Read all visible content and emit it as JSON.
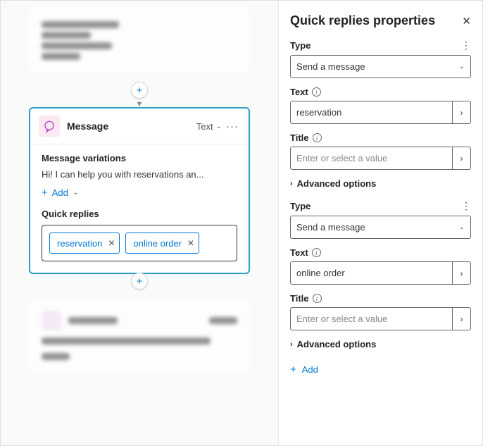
{
  "panel": {
    "title": "Quick replies properties",
    "type_label": "Type",
    "text_label": "Text",
    "title_label": "Title",
    "title_placeholder": "Enter or select a value",
    "advanced_label": "Advanced options",
    "add_label": "Add",
    "replies": [
      {
        "type_value": "Send a message",
        "text_value": "reservation"
      },
      {
        "type_value": "Send a message",
        "text_value": "online order"
      }
    ]
  },
  "node": {
    "title": "Message",
    "output_mode": "Text",
    "variations_label": "Message variations",
    "variation_preview": "Hi! I can help you with reservations an...",
    "add_label": "Add",
    "quick_replies_label": "Quick replies",
    "chips": [
      "reservation",
      "online order"
    ]
  }
}
